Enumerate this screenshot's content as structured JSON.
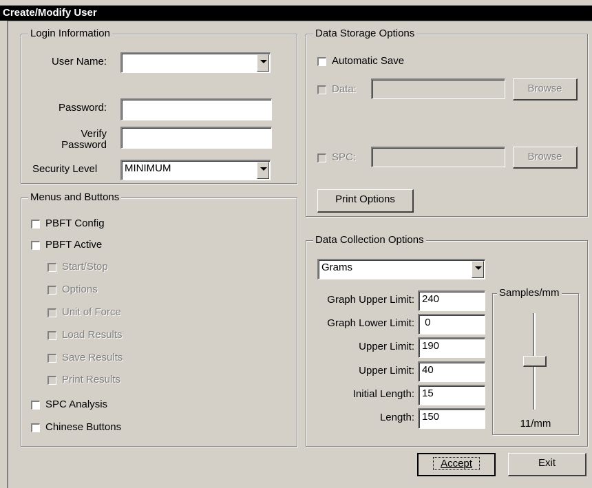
{
  "window": {
    "title": "Create/Modify User"
  },
  "login": {
    "legend": "Login Information",
    "username_label": "User Name:",
    "username_value": "",
    "password_label": "Password:",
    "verify_label_line1": "Verify",
    "verify_label_line2": "Password",
    "security_label": "Security Level",
    "security_value": "MINIMUM"
  },
  "menus": {
    "legend": "Menus and Buttons",
    "items": [
      {
        "label": "PBFT Config",
        "enabled": true,
        "checked": false
      },
      {
        "label": "PBFT Active",
        "enabled": true,
        "checked": false
      },
      {
        "label": "Start/Stop",
        "enabled": false,
        "checked": false
      },
      {
        "label": "Options",
        "enabled": false,
        "checked": false
      },
      {
        "label": "Unit of Force",
        "enabled": false,
        "checked": false
      },
      {
        "label": "Load Results",
        "enabled": false,
        "checked": false
      },
      {
        "label": "Save Results",
        "enabled": false,
        "checked": false
      },
      {
        "label": "Print Results",
        "enabled": false,
        "checked": false
      },
      {
        "label": "SPC Analysis",
        "enabled": true,
        "checked": false
      },
      {
        "label": "Chinese Buttons",
        "enabled": true,
        "checked": false
      }
    ]
  },
  "storage": {
    "legend": "Data Storage Options",
    "auto_save": "Automatic Save",
    "data_label": "Data:",
    "data_path": "",
    "spc_label": "SPC:",
    "spc_path": "",
    "browse": "Browse",
    "print_options": "Print Options"
  },
  "collection": {
    "legend": "Data Collection Options",
    "unit_value": "Grams",
    "fields": [
      {
        "label": "Graph Upper Limit:",
        "value": "240"
      },
      {
        "label": "Graph Lower Limit:",
        "value": " 0"
      },
      {
        "label": "Upper Limit:",
        "value": "190"
      },
      {
        "label": "Upper Limit:",
        "value": "40"
      },
      {
        "label": "Initial Length:",
        "value": "15"
      },
      {
        "label": "Length:",
        "value": "150"
      }
    ],
    "samples_legend": "Samples/mm",
    "samples_value": "11/mm",
    "samples_level": 0.5
  },
  "actions": {
    "accept": "Accept",
    "exit": "Exit"
  }
}
